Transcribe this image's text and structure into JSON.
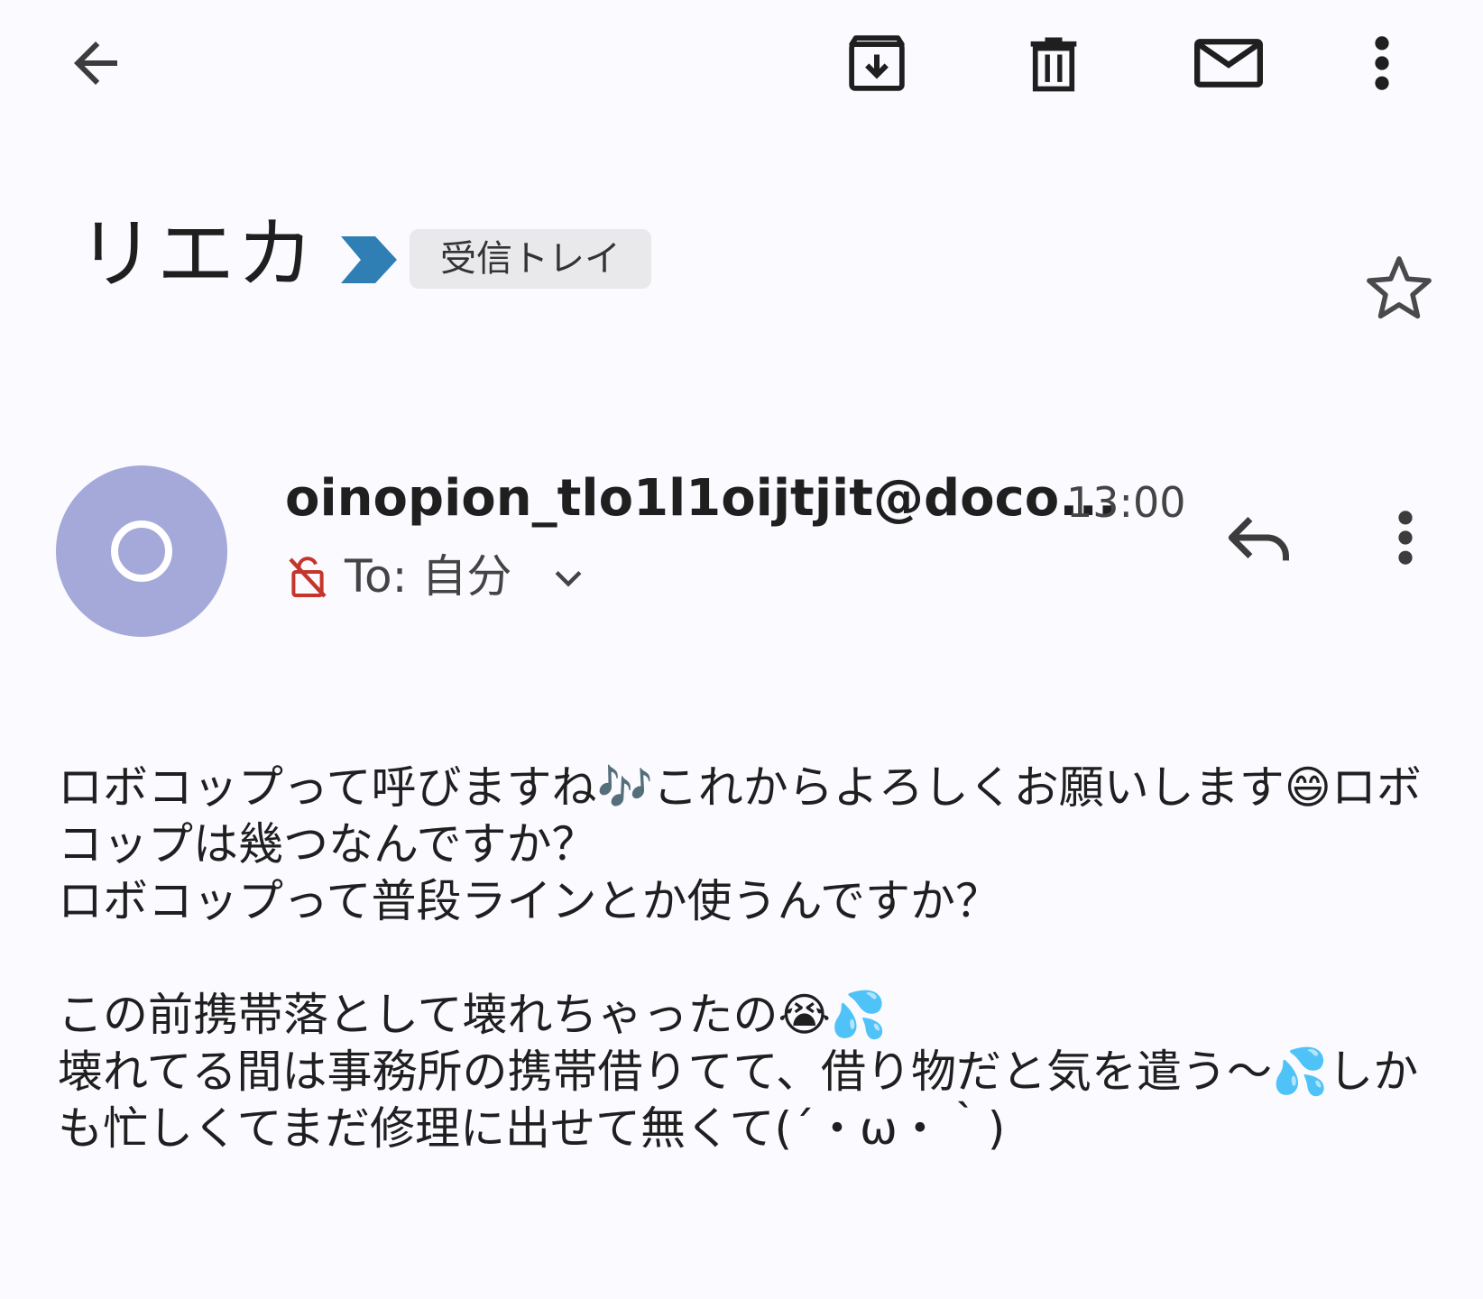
{
  "toolbar": {
    "back_icon": "arrow-back-icon",
    "archive_icon": "archive-icon",
    "delete_icon": "trash-icon",
    "mark_unread_icon": "mail-icon",
    "more_icon": "more-vert-icon"
  },
  "subject": {
    "title": "リエカ",
    "importance_icon": "importance-marker-icon",
    "importance_color": "#2f7fb5",
    "label": "受信トレイ",
    "star_icon": "star-outline-icon"
  },
  "sender": {
    "avatar_letter": "O",
    "avatar_color": "#a4a9da",
    "name": "oinopion_tlo1l1oijtjit@doco...",
    "time": "13:00",
    "recipient": "To: 自分",
    "unencrypted_icon": "lock-off-icon",
    "unencrypted_color": "#c5352a",
    "expand_icon": "chevron-down-icon",
    "reply_icon": "reply-icon",
    "more_icon": "more-vert-icon"
  },
  "body": {
    "text": "ロボコップって呼びますね🎶これからよろしくお願いします😄ロボコップは幾つなんですか？\nロボコップって普段ラインとか使うんですか？\n\nこの前携帯落として壊れちゃったの😭💦\n壊れてる間は事務所の携帯借りてて、借り物だと気を遣う〜💦しかも忙しくてまだ修理に出せて無くて(´・ω・｀)"
  }
}
